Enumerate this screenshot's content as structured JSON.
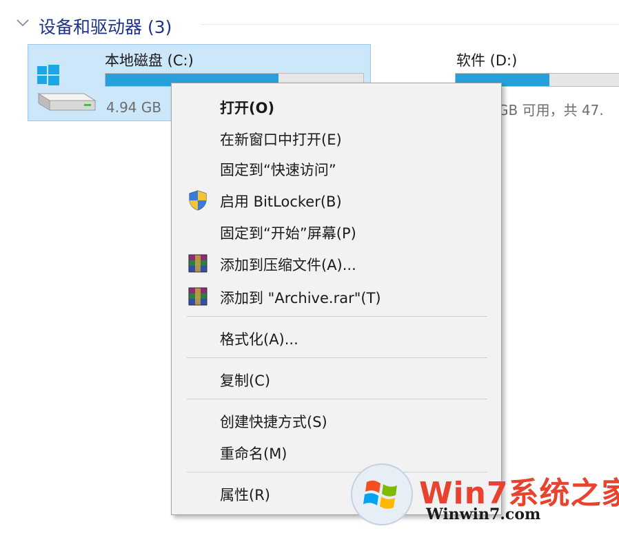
{
  "section": {
    "title": "设备和驱动器 (3)",
    "chevron_icon": "chevron-down-icon"
  },
  "drives": [
    {
      "name": "本地磁盘 (C:)",
      "subtitle": "4.94 GB",
      "usage_fraction": 0.67,
      "icon": "windows-drive-icon",
      "selected": true
    },
    {
      "name": "软件 (D:)",
      "subtitle": "GB 可用，共 47.",
      "usage_fraction": 0.57,
      "selected": false
    }
  ],
  "menu": {
    "items": [
      {
        "label": "打开(O)",
        "bold": true,
        "icon": ""
      },
      {
        "label": "在新窗口中打开(E)",
        "icon": ""
      },
      {
        "label": "固定到“快速访问”",
        "icon": ""
      },
      {
        "label": "启用 BitLocker(B)",
        "icon": "shield-icon"
      },
      {
        "label": "固定到“开始”屏幕(P)",
        "icon": ""
      },
      {
        "label": "添加到压缩文件(A)...",
        "icon": "winrar-icon"
      },
      {
        "label": "添加到 \"Archive.rar\"(T)",
        "icon": "winrar-icon"
      },
      {
        "label": "格式化(A)...",
        "icon": ""
      },
      {
        "label": "复制(C)",
        "icon": ""
      },
      {
        "label": "创建快捷方式(S)",
        "icon": ""
      },
      {
        "label": "重命名(M)",
        "icon": ""
      },
      {
        "label": "属性(R)",
        "icon": ""
      }
    ]
  },
  "watermark": {
    "brand": "Win7系统之家",
    "url": "Winwin7.com",
    "icon": "windows7-logo-icon"
  },
  "colors": {
    "accent": "#26a0da",
    "selection": "#cce6fa",
    "header_text": "#1e3287",
    "menu_bg": "#f2f2f2",
    "watermark_red": "#e8432e"
  }
}
